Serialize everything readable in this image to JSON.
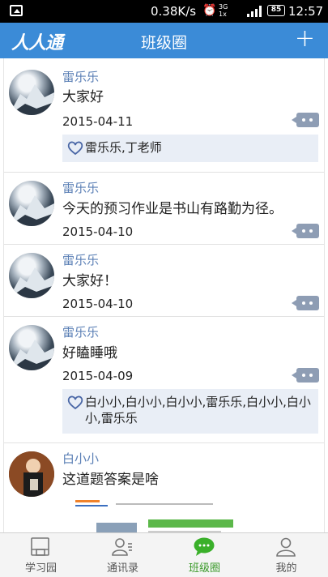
{
  "status_bar": {
    "speed": "0.38K/s",
    "network": "3G",
    "network_sub": "1x",
    "battery": "85",
    "time": "12:57"
  },
  "header": {
    "logo": "人人通",
    "title": "班级圈"
  },
  "posts": [
    {
      "name": "雷乐乐",
      "text": "大家好",
      "date": "2015-04-11",
      "likes": "雷乐乐,丁老师"
    },
    {
      "name": "雷乐乐",
      "text": "今天的预习作业是书山有路勤为径。",
      "date": "2015-04-10"
    },
    {
      "name": "雷乐乐",
      "text": "大家好！",
      "date": "2015-04-10"
    },
    {
      "name": "雷乐乐",
      "text": "好瞌睡哦",
      "date": "2015-04-09",
      "likes": "白小小,白小小,白小小,雷乐乐,白小小,白小小,雷乐乐"
    },
    {
      "name": "白小小",
      "text": "这道题答案是啥"
    }
  ],
  "tabs": [
    {
      "label": "学习园",
      "icon": "book-icon"
    },
    {
      "label": "通讯录",
      "icon": "contacts-icon"
    },
    {
      "label": "班级圈",
      "icon": "chat-bubble-icon",
      "active": true
    },
    {
      "label": "我的",
      "icon": "person-icon"
    }
  ],
  "colors": {
    "header": "#3b8bd7",
    "name": "#5a7fb5",
    "active_tab": "#3a9a2a",
    "comment_button": "#8e9db4",
    "likes_bg": "#e9eef6"
  }
}
